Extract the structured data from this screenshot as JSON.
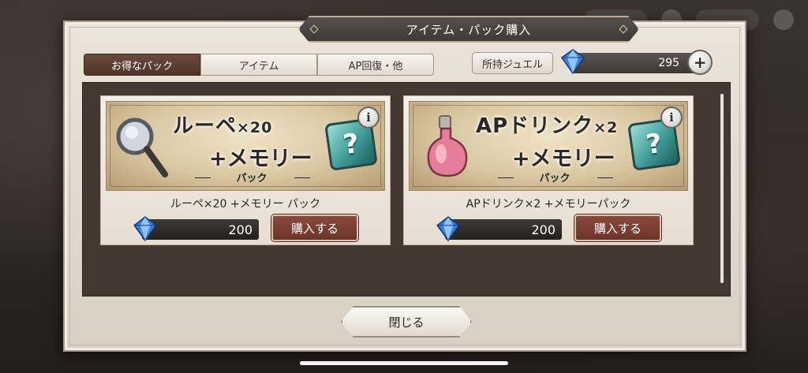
{
  "dialog": {
    "title": "アイテム・パック購入"
  },
  "tabs": [
    {
      "label": "お得なパック",
      "active": true
    },
    {
      "label": "アイテム",
      "active": false
    },
    {
      "label": "AP回復・他",
      "active": false
    }
  ],
  "jewel": {
    "owned_label": "所持ジュエル",
    "amount": "295",
    "add_icon": "plus-icon"
  },
  "packs": [
    {
      "banner_line1": "ルーペ",
      "banner_line1_suffix": "×20",
      "banner_line2": "+メモリー",
      "banner_line3": "パック",
      "name": "ルーペ×20 +メモリー パック",
      "price": "200",
      "buy_label": "購入する",
      "icon": "magnifier-icon"
    },
    {
      "banner_line1": "APドリンク",
      "banner_line1_suffix": "×2",
      "banner_line2": "+メモリー",
      "banner_line3": "パック",
      "name": "APドリンク×2 +メモリーパック",
      "price": "200",
      "buy_label": "購入する",
      "icon": "potion-icon"
    }
  ],
  "info_label": "i",
  "mystery_glyph": "?",
  "close_label": "閉じる",
  "colors": {
    "accent": "#6b3429",
    "tab_active": "#4d342a",
    "panel": "#433832"
  }
}
